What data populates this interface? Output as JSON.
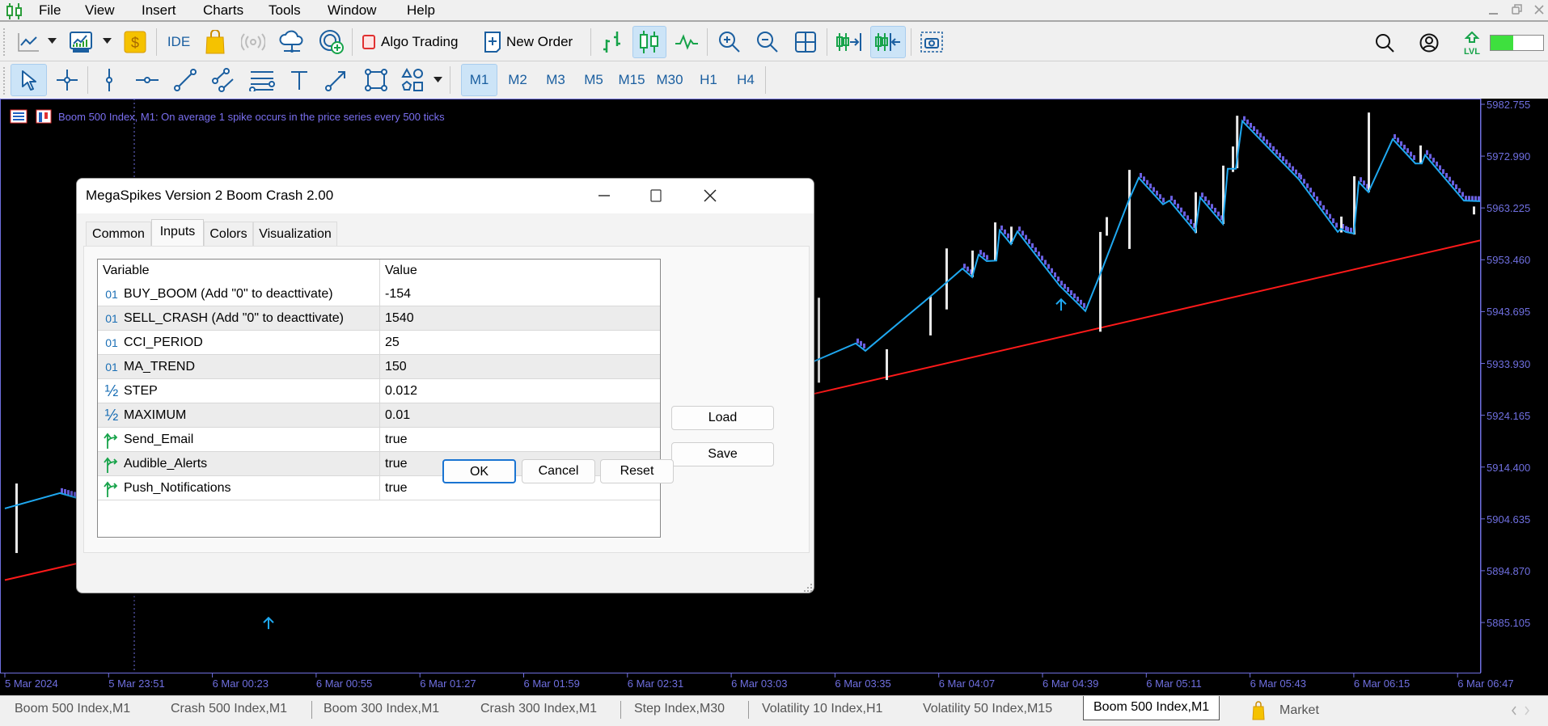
{
  "menu": {
    "items": [
      "File",
      "View",
      "Insert",
      "Charts",
      "Tools",
      "Window",
      "Help"
    ]
  },
  "toolbar": {
    "ide_label": "IDE",
    "algo_trading_label": "Algo Trading",
    "new_order_label": "New Order",
    "level_label": "LVL",
    "level_progress": 0.43,
    "timeframes": [
      "M1",
      "M2",
      "M3",
      "M5",
      "M15",
      "M30",
      "H1",
      "H4"
    ],
    "active_timeframe": "M1"
  },
  "chart": {
    "title": "Boom 500 Index, M1:  On average 1 spike occurs in the price series every 500 ticks",
    "colors": {
      "background": "#000000",
      "price_line": "#1fa8f0",
      "trend_line": "#ff1a1a",
      "bear_candle": "#6a5fe0",
      "spike": "#e8e8e8",
      "axis": "#6f6fe0"
    }
  },
  "chart_data": {
    "type": "line",
    "title": "Boom 500 Index, M1",
    "price_axis_ticks": [
      "5982.755",
      "5972.990",
      "5963.225",
      "5953.460",
      "5943.695",
      "5933.930",
      "5924.165",
      "5914.400",
      "5904.635",
      "5894.870",
      "5885.105"
    ],
    "time_axis_ticks": [
      "5 Mar 2024",
      "5 Mar 23:51",
      "6 Mar 00:23",
      "6 Mar 00:55",
      "6 Mar 01:27",
      "6 Mar 01:59",
      "6 Mar 02:31",
      "6 Mar 03:03",
      "6 Mar 03:35",
      "6 Mar 04:07",
      "6 Mar 04:39",
      "6 Mar 05:11",
      "6 Mar 05:43",
      "6 Mar 06:15",
      "6 Mar 06:47"
    ],
    "x_unit": "minutes since first time tick",
    "ylim": [
      5878,
      5985
    ],
    "price_line": [
      [
        0,
        5906.6
      ],
      [
        17,
        5909.5
      ],
      [
        60,
        5902
      ],
      [
        110,
        5893
      ],
      [
        150,
        5905
      ],
      [
        200,
        5915
      ],
      [
        248.5,
        5933.9
      ],
      [
        263,
        5937.7
      ],
      [
        266,
        5936.3
      ],
      [
        286,
        5946.5
      ],
      [
        296,
        5951.8
      ],
      [
        299,
        5950.2
      ],
      [
        301,
        5954.4
      ],
      [
        303.5,
        5953.2
      ],
      [
        306.5,
        5953.3
      ],
      [
        307.5,
        5959.0
      ],
      [
        311,
        5956.4
      ],
      [
        313,
        5958.8
      ],
      [
        326,
        5948.6
      ],
      [
        334,
        5943.8
      ],
      [
        339,
        5951.4
      ],
      [
        347.5,
        5964.8
      ],
      [
        350.5,
        5968.9
      ],
      [
        358,
        5963.9
      ],
      [
        360,
        5964.6
      ],
      [
        368,
        5958.7
      ],
      [
        369.5,
        5965.2
      ],
      [
        376.5,
        5960.2
      ],
      [
        378,
        5970.6
      ],
      [
        380.5,
        5970.6
      ],
      [
        382.5,
        5979.6
      ],
      [
        400,
        5968.6
      ],
      [
        412,
        5958.7
      ],
      [
        413,
        5959.3
      ],
      [
        414.5,
        5958.7
      ],
      [
        417,
        5958.4
      ],
      [
        418.5,
        5968.1
      ],
      [
        421.5,
        5966.2
      ],
      [
        429,
        5976.2
      ],
      [
        436,
        5971.6
      ],
      [
        438,
        5971.6
      ],
      [
        439,
        5973.2
      ],
      [
        451,
        5964.6
      ],
      [
        456,
        5964.5
      ]
    ],
    "trend_line": [
      [
        0,
        5893.1
      ],
      [
        456,
        5957.1
      ]
    ],
    "spikes": [
      [
        3.5,
        5898.2,
        5911.3
      ],
      [
        251.5,
        5930.3,
        5946.3
      ],
      [
        272.5,
        5930.8,
        5936.6
      ],
      [
        286,
        5939.2,
        5946.5
      ],
      [
        291,
        5944.1,
        5955.6
      ],
      [
        299,
        5950.2,
        5955.2
      ],
      [
        306,
        5953.3,
        5960.5
      ],
      [
        311,
        5956.4,
        5959.7
      ],
      [
        338.5,
        5939.9,
        5958.7
      ],
      [
        340.5,
        5958.0,
        5961.5
      ],
      [
        347.5,
        5955.5,
        5970.4
      ],
      [
        368,
        5958.5,
        5966.2
      ],
      [
        376.5,
        5960.2,
        5971.2
      ],
      [
        379.5,
        5970.0,
        5974.8
      ],
      [
        380.8,
        5970.7,
        5980.6
      ],
      [
        413,
        5958.6,
        5961.6
      ],
      [
        417,
        5958.2,
        5969.2
      ],
      [
        421.5,
        5966.2,
        5981.2
      ],
      [
        437.5,
        5971.6,
        5975.0
      ],
      [
        454,
        5962.0,
        5963.5
      ]
    ],
    "signals": [
      {
        "minute": 326.5,
        "price": 5946.0,
        "dir": "up"
      },
      {
        "minute": 81.5,
        "price": 5886.0,
        "dir": "up"
      }
    ],
    "period_separator_minute": 40
  },
  "tabs": [
    {
      "label": "Boom 500 Index,M1",
      "active": false
    },
    {
      "label": "Crash 500 Index,M1",
      "active": false
    },
    {
      "label": "Boom 300 Index,M1",
      "active": false
    },
    {
      "label": "Crash 300 Index,M1",
      "active": false
    },
    {
      "label": "Step Index,M30",
      "active": false
    },
    {
      "label": "Volatility 10 Index,H1",
      "active": false
    },
    {
      "label": "Volatility 50 Index,M15",
      "active": false
    },
    {
      "label": "Boom 500 Index,M1",
      "active": true
    },
    {
      "label": "Market",
      "active": false
    }
  ],
  "dialog": {
    "title": "MegaSpikes Version 2 Boom Crash 2.00",
    "tabs": [
      "Common",
      "Inputs",
      "Colors",
      "Visualization"
    ],
    "active_tab": "Inputs",
    "columns": [
      "Variable",
      "Value"
    ],
    "params": [
      {
        "type": "int",
        "name": "BUY_BOOM (Add \"0\" to deacttivate)",
        "value": "-154"
      },
      {
        "type": "int",
        "name": "SELL_CRASH (Add \"0\" to deacttivate)",
        "value": "1540"
      },
      {
        "type": "int",
        "name": "CCI_PERIOD",
        "value": "25"
      },
      {
        "type": "int",
        "name": "MA_TREND",
        "value": "150"
      },
      {
        "type": "double",
        "name": "STEP",
        "value": "0.012"
      },
      {
        "type": "double",
        "name": "MAXIMUM",
        "value": "0.01"
      },
      {
        "type": "bool",
        "name": "Send_Email",
        "value": "true"
      },
      {
        "type": "bool",
        "name": "Audible_Alerts",
        "value": "true"
      },
      {
        "type": "bool",
        "name": "Push_Notifications",
        "value": "true"
      }
    ],
    "load_label": "Load",
    "save_label": "Save",
    "ok_label": "OK",
    "cancel_label": "Cancel",
    "reset_label": "Reset"
  }
}
